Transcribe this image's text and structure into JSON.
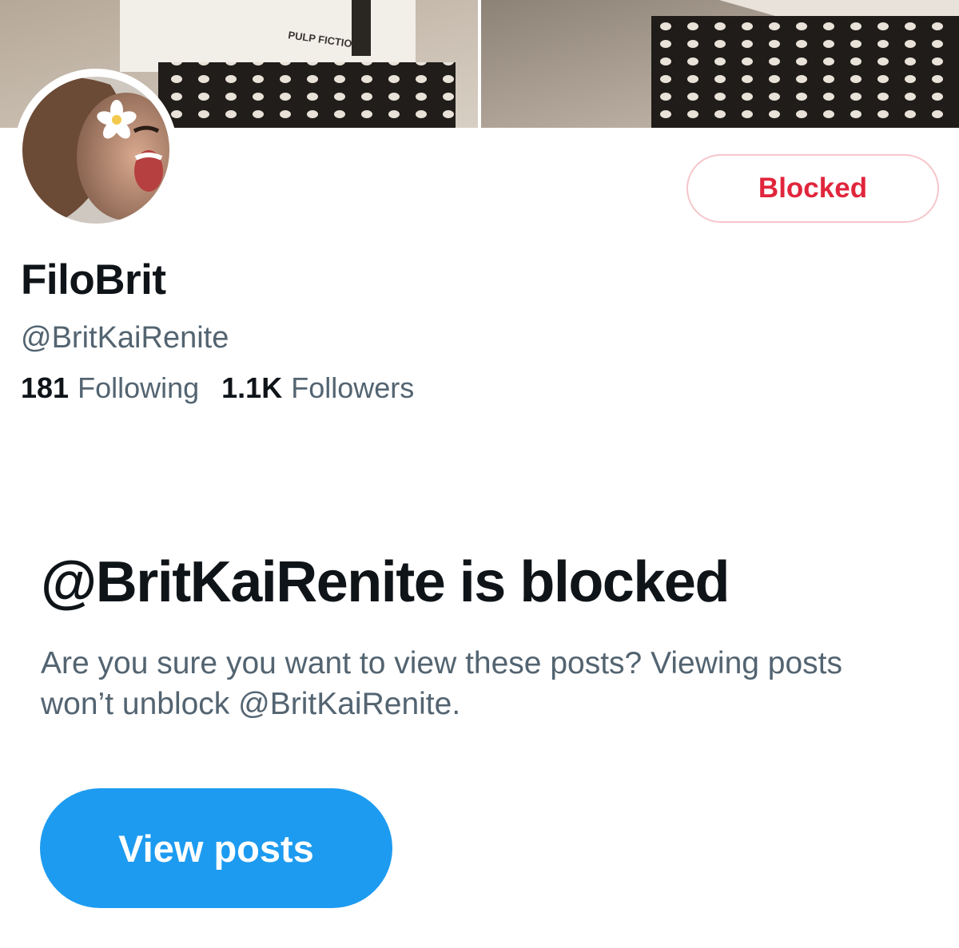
{
  "profile": {
    "display_name": "FiloBrit",
    "handle": "@BritKaiRenite",
    "blocked_button_label": "Blocked",
    "banner_shirt_text": "PULP FICTION",
    "stats": {
      "following_count": "181",
      "following_label": "Following",
      "followers_count": "1.1K",
      "followers_label": "Followers"
    }
  },
  "blocked_notice": {
    "title": "@BritKaiRenite is blocked",
    "description": "Are you sure you want to view these posts? Viewing posts won’t unblock @BritKaiRenite.",
    "view_button_label": "View posts"
  },
  "colors": {
    "blocked_red": "#e0263c",
    "primary_blue": "#1d9bf0",
    "secondary_text": "#536471",
    "primary_text": "#0f1419"
  },
  "icons": {
    "banner": "header-photo",
    "avatar": "profile-photo"
  }
}
